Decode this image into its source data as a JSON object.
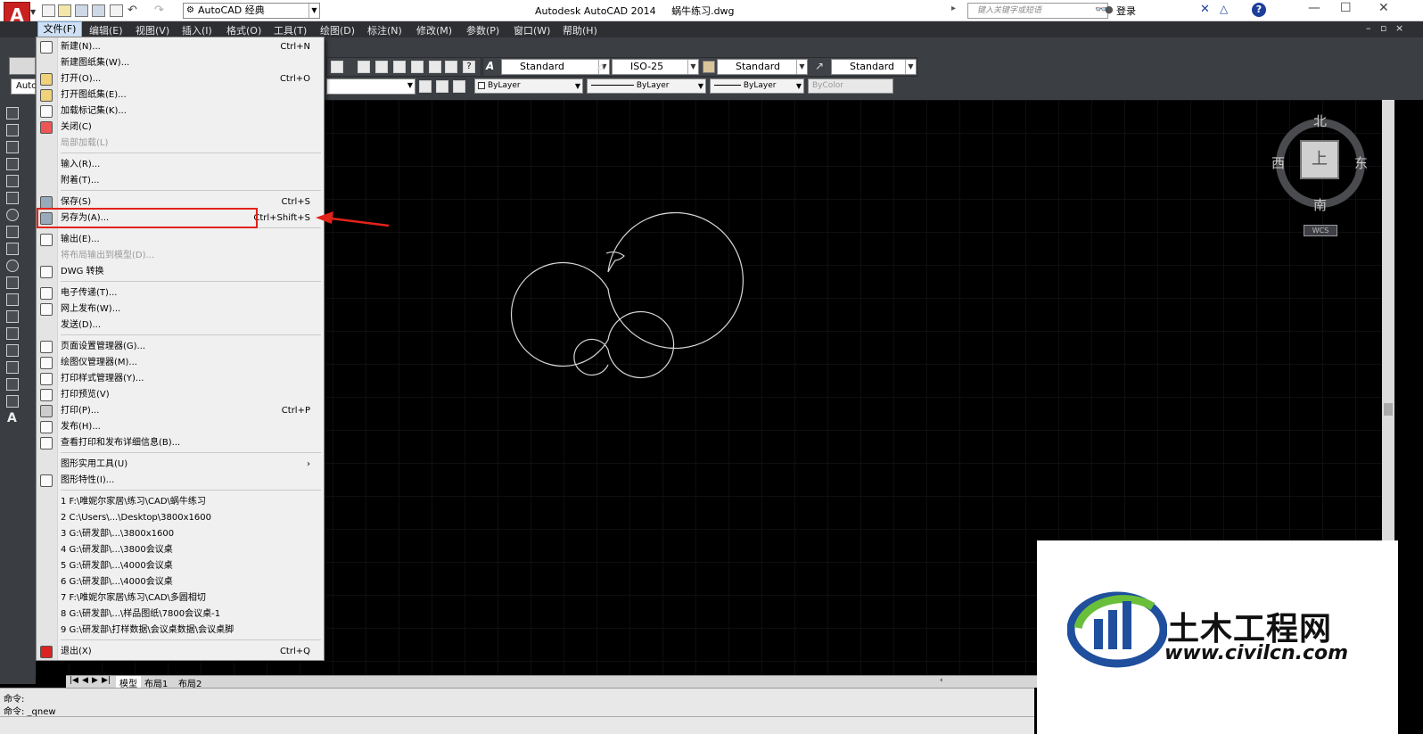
{
  "titlebar": {
    "app_logo": "A",
    "workspace": "AutoCAD 经典",
    "title": "Autodesk AutoCAD 2014",
    "filename": "蜗牛练习.dwg",
    "search_placeholder": "键入关键字或短语",
    "login": "登录",
    "help": "?",
    "min": "—",
    "max": "☐",
    "close": "✕"
  },
  "menubar": {
    "items": [
      "文件(F)",
      "编辑(E)",
      "视图(V)",
      "插入(I)",
      "格式(O)",
      "工具(T)",
      "绘图(D)",
      "标注(N)",
      "修改(M)",
      "参数(P)",
      "窗口(W)",
      "帮助(H)"
    ]
  },
  "toolbar": {
    "text_style": "Standard",
    "dim_style": "ISO-25",
    "table_style": "Standard",
    "mleader_style": "Standard",
    "layer_partial": "Autc",
    "color": "ByLayer",
    "linetype": "ByLayer",
    "lineweight": "ByLayer",
    "plotstyle": "ByColor"
  },
  "file_menu": {
    "items": [
      {
        "label": "新建(N)...",
        "shortcut": "Ctrl+N",
        "icon": "new-file-icon"
      },
      {
        "label": "新建图纸集(W)...",
        "shortcut": "",
        "icon": ""
      },
      {
        "label": "打开(O)...",
        "shortcut": "Ctrl+O",
        "icon": "open-folder-icon"
      },
      {
        "label": "打开图纸集(E)...",
        "shortcut": "",
        "icon": "open-sheetset-icon"
      },
      {
        "label": "加载标记集(K)...",
        "shortcut": "",
        "icon": "markup-icon"
      },
      {
        "label": "关闭(C)",
        "shortcut": "",
        "icon": "close-file-icon"
      },
      {
        "label": "局部加载(L)",
        "shortcut": "",
        "icon": ""
      },
      {
        "label": "输入(R)...",
        "shortcut": "",
        "icon": ""
      },
      {
        "label": "附着(T)...",
        "shortcut": "",
        "icon": ""
      },
      {
        "label": "保存(S)",
        "shortcut": "Ctrl+S",
        "icon": "save-icon"
      },
      {
        "label": "另存为(A)...",
        "shortcut": "Ctrl+Shift+S",
        "icon": "save-as-icon"
      },
      {
        "label": "输出(E)...",
        "shortcut": "",
        "icon": "export-icon"
      },
      {
        "label": "将布局输出到模型(D)...",
        "shortcut": "",
        "icon": ""
      },
      {
        "label": "DWG 转换",
        "shortcut": "",
        "icon": "dwg-convert-icon"
      },
      {
        "label": "电子传递(T)...",
        "shortcut": "",
        "icon": "etransmit-icon"
      },
      {
        "label": "网上发布(W)...",
        "shortcut": "",
        "icon": "publish-web-icon"
      },
      {
        "label": "发送(D)...",
        "shortcut": "",
        "icon": ""
      },
      {
        "label": "页面设置管理器(G)...",
        "shortcut": "",
        "icon": "page-setup-icon"
      },
      {
        "label": "绘图仪管理器(M)...",
        "shortcut": "",
        "icon": "plotter-icon"
      },
      {
        "label": "打印样式管理器(Y)...",
        "shortcut": "",
        "icon": "plot-style-icon"
      },
      {
        "label": "打印预览(V)",
        "shortcut": "",
        "icon": "preview-icon"
      },
      {
        "label": "打印(P)...",
        "shortcut": "Ctrl+P",
        "icon": "print-icon"
      },
      {
        "label": "发布(H)...",
        "shortcut": "",
        "icon": "publish-icon"
      },
      {
        "label": "查看打印和发布详细信息(B)...",
        "shortcut": "",
        "icon": "plot-details-icon"
      },
      {
        "label": "图形实用工具(U)",
        "shortcut": "›",
        "icon": ""
      },
      {
        "label": "图形特性(I)...",
        "shortcut": "",
        "icon": "drawing-props-icon"
      },
      {
        "label": "1 F:\\唯妮尔家居\\练习\\CAD\\蜗牛练习",
        "shortcut": "",
        "icon": ""
      },
      {
        "label": "2 C:\\Users\\...\\Desktop\\3800x1600",
        "shortcut": "",
        "icon": ""
      },
      {
        "label": "3 G:\\研发部\\...\\3800x1600",
        "shortcut": "",
        "icon": ""
      },
      {
        "label": "4 G:\\研发部\\...\\3800会议桌",
        "shortcut": "",
        "icon": ""
      },
      {
        "label": "5 G:\\研发部\\...\\4000会议桌",
        "shortcut": "",
        "icon": ""
      },
      {
        "label": "6 G:\\研发部\\...\\4000会议桌",
        "shortcut": "",
        "icon": ""
      },
      {
        "label": "7 F:\\唯妮尔家居\\练习\\CAD\\多圆相切",
        "shortcut": "",
        "icon": ""
      },
      {
        "label": "8 G:\\研发部\\...\\样品图纸\\7800会议桌-1",
        "shortcut": "",
        "icon": ""
      },
      {
        "label": "9 G:\\研发部\\打样数据\\会议桌数据\\会议桌脚",
        "shortcut": "",
        "icon": ""
      },
      {
        "label": "退出(X)",
        "shortcut": "Ctrl+Q",
        "icon": "exit-icon"
      }
    ]
  },
  "viewcube": {
    "north": "北",
    "south": "南",
    "east": "东",
    "west": "西",
    "top": "上",
    "wcs": "WCS"
  },
  "layout_tabs": [
    "模型",
    "布局1",
    "布局2"
  ],
  "command": {
    "line1": "命令:",
    "line2": "命令:  _qnew"
  },
  "watermark": {
    "brand": "土木工程网",
    "url": "www.civilcn.com"
  },
  "colors": {
    "highlight": "#e2231a",
    "accent": "#c8211f",
    "watermark_blue": "#1f4f9d",
    "watermark_green": "#6abf3a"
  }
}
